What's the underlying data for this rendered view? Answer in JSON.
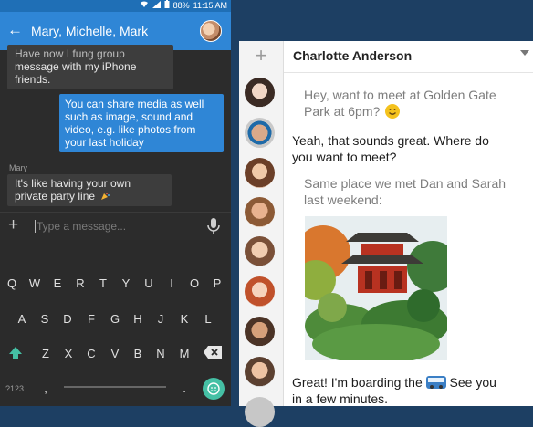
{
  "phone": {
    "status": {
      "battery": "88%",
      "time": "11:15 AM"
    },
    "header": {
      "title": "Mary, Michelle, Mark"
    },
    "messages": [
      {
        "type": "in",
        "lines": [
          "Have now I fung group",
          "message with my iPhone",
          "friends."
        ]
      },
      {
        "type": "out",
        "lines": [
          "You can share media as well",
          "such as image, sound and",
          "video, e.g. like photos from",
          "your last holiday"
        ]
      },
      {
        "type": "in",
        "sender": "Mary",
        "lines": [
          "It's like having your own",
          "private party line"
        ]
      }
    ],
    "composer": {
      "placeholder": "Type a message..."
    },
    "keyboard": {
      "row1": [
        "Q",
        "W",
        "E",
        "R",
        "T",
        "Y",
        "U",
        "I",
        "O",
        "P"
      ],
      "row2": [
        "A",
        "S",
        "D",
        "F",
        "G",
        "H",
        "J",
        "K",
        "L"
      ],
      "row3": [
        "Z",
        "X",
        "C",
        "V",
        "B",
        "N",
        "M"
      ],
      "bottom": {
        "sym": "?123",
        "comma": ",",
        "period": "."
      }
    }
  },
  "tablet": {
    "contact_name": "Charlotte Anderson",
    "add_label": "+",
    "messages": [
      {
        "style": "gray",
        "lines": [
          "Hey, want to meet at Golden Gate",
          "Park at 6pm?"
        ]
      },
      {
        "style": "dark",
        "lines": [
          "Yeah, that sounds great. Where do",
          "you want to meet?"
        ]
      },
      {
        "style": "gray",
        "lines": [
          "Same place we met Dan and Sarah",
          "last weekend:"
        ]
      },
      {
        "style": "dark",
        "lines": [
          "Great! I'm boarding the",
          "See you",
          "in a few minutes."
        ]
      }
    ]
  },
  "colors": {
    "accent_blue": "#2f86d6",
    "status_blue": "#1f6fb6",
    "keyboard_bg": "#2b2b2b",
    "emoji_key": "#45c0a5"
  },
  "icons": [
    "back-arrow-icon",
    "wifi-icon",
    "signal-icon",
    "battery-icon",
    "plus-icon",
    "mic-icon",
    "shift-icon",
    "backspace-icon",
    "emoji-icon",
    "smiley-emoji-icon",
    "bus-emoji-icon",
    "dropdown-icon"
  ]
}
